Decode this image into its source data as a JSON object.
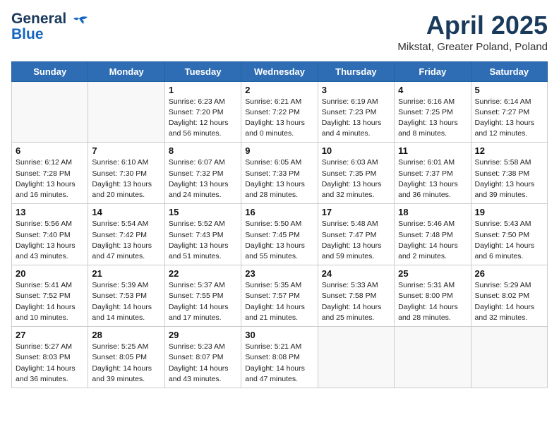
{
  "header": {
    "logo_line1": "General",
    "logo_line2": "Blue",
    "month_year": "April 2025",
    "location": "Mikstat, Greater Poland, Poland"
  },
  "weekdays": [
    "Sunday",
    "Monday",
    "Tuesday",
    "Wednesday",
    "Thursday",
    "Friday",
    "Saturday"
  ],
  "weeks": [
    [
      {
        "day": "",
        "sunrise": "",
        "sunset": "",
        "daylight": ""
      },
      {
        "day": "",
        "sunrise": "",
        "sunset": "",
        "daylight": ""
      },
      {
        "day": "1",
        "sunrise": "Sunrise: 6:23 AM",
        "sunset": "Sunset: 7:20 PM",
        "daylight": "Daylight: 12 hours and 56 minutes."
      },
      {
        "day": "2",
        "sunrise": "Sunrise: 6:21 AM",
        "sunset": "Sunset: 7:22 PM",
        "daylight": "Daylight: 13 hours and 0 minutes."
      },
      {
        "day": "3",
        "sunrise": "Sunrise: 6:19 AM",
        "sunset": "Sunset: 7:23 PM",
        "daylight": "Daylight: 13 hours and 4 minutes."
      },
      {
        "day": "4",
        "sunrise": "Sunrise: 6:16 AM",
        "sunset": "Sunset: 7:25 PM",
        "daylight": "Daylight: 13 hours and 8 minutes."
      },
      {
        "day": "5",
        "sunrise": "Sunrise: 6:14 AM",
        "sunset": "Sunset: 7:27 PM",
        "daylight": "Daylight: 13 hours and 12 minutes."
      }
    ],
    [
      {
        "day": "6",
        "sunrise": "Sunrise: 6:12 AM",
        "sunset": "Sunset: 7:28 PM",
        "daylight": "Daylight: 13 hours and 16 minutes."
      },
      {
        "day": "7",
        "sunrise": "Sunrise: 6:10 AM",
        "sunset": "Sunset: 7:30 PM",
        "daylight": "Daylight: 13 hours and 20 minutes."
      },
      {
        "day": "8",
        "sunrise": "Sunrise: 6:07 AM",
        "sunset": "Sunset: 7:32 PM",
        "daylight": "Daylight: 13 hours and 24 minutes."
      },
      {
        "day": "9",
        "sunrise": "Sunrise: 6:05 AM",
        "sunset": "Sunset: 7:33 PM",
        "daylight": "Daylight: 13 hours and 28 minutes."
      },
      {
        "day": "10",
        "sunrise": "Sunrise: 6:03 AM",
        "sunset": "Sunset: 7:35 PM",
        "daylight": "Daylight: 13 hours and 32 minutes."
      },
      {
        "day": "11",
        "sunrise": "Sunrise: 6:01 AM",
        "sunset": "Sunset: 7:37 PM",
        "daylight": "Daylight: 13 hours and 36 minutes."
      },
      {
        "day": "12",
        "sunrise": "Sunrise: 5:58 AM",
        "sunset": "Sunset: 7:38 PM",
        "daylight": "Daylight: 13 hours and 39 minutes."
      }
    ],
    [
      {
        "day": "13",
        "sunrise": "Sunrise: 5:56 AM",
        "sunset": "Sunset: 7:40 PM",
        "daylight": "Daylight: 13 hours and 43 minutes."
      },
      {
        "day": "14",
        "sunrise": "Sunrise: 5:54 AM",
        "sunset": "Sunset: 7:42 PM",
        "daylight": "Daylight: 13 hours and 47 minutes."
      },
      {
        "day": "15",
        "sunrise": "Sunrise: 5:52 AM",
        "sunset": "Sunset: 7:43 PM",
        "daylight": "Daylight: 13 hours and 51 minutes."
      },
      {
        "day": "16",
        "sunrise": "Sunrise: 5:50 AM",
        "sunset": "Sunset: 7:45 PM",
        "daylight": "Daylight: 13 hours and 55 minutes."
      },
      {
        "day": "17",
        "sunrise": "Sunrise: 5:48 AM",
        "sunset": "Sunset: 7:47 PM",
        "daylight": "Daylight: 13 hours and 59 minutes."
      },
      {
        "day": "18",
        "sunrise": "Sunrise: 5:46 AM",
        "sunset": "Sunset: 7:48 PM",
        "daylight": "Daylight: 14 hours and 2 minutes."
      },
      {
        "day": "19",
        "sunrise": "Sunrise: 5:43 AM",
        "sunset": "Sunset: 7:50 PM",
        "daylight": "Daylight: 14 hours and 6 minutes."
      }
    ],
    [
      {
        "day": "20",
        "sunrise": "Sunrise: 5:41 AM",
        "sunset": "Sunset: 7:52 PM",
        "daylight": "Daylight: 14 hours and 10 minutes."
      },
      {
        "day": "21",
        "sunrise": "Sunrise: 5:39 AM",
        "sunset": "Sunset: 7:53 PM",
        "daylight": "Daylight: 14 hours and 14 minutes."
      },
      {
        "day": "22",
        "sunrise": "Sunrise: 5:37 AM",
        "sunset": "Sunset: 7:55 PM",
        "daylight": "Daylight: 14 hours and 17 minutes."
      },
      {
        "day": "23",
        "sunrise": "Sunrise: 5:35 AM",
        "sunset": "Sunset: 7:57 PM",
        "daylight": "Daylight: 14 hours and 21 minutes."
      },
      {
        "day": "24",
        "sunrise": "Sunrise: 5:33 AM",
        "sunset": "Sunset: 7:58 PM",
        "daylight": "Daylight: 14 hours and 25 minutes."
      },
      {
        "day": "25",
        "sunrise": "Sunrise: 5:31 AM",
        "sunset": "Sunset: 8:00 PM",
        "daylight": "Daylight: 14 hours and 28 minutes."
      },
      {
        "day": "26",
        "sunrise": "Sunrise: 5:29 AM",
        "sunset": "Sunset: 8:02 PM",
        "daylight": "Daylight: 14 hours and 32 minutes."
      }
    ],
    [
      {
        "day": "27",
        "sunrise": "Sunrise: 5:27 AM",
        "sunset": "Sunset: 8:03 PM",
        "daylight": "Daylight: 14 hours and 36 minutes."
      },
      {
        "day": "28",
        "sunrise": "Sunrise: 5:25 AM",
        "sunset": "Sunset: 8:05 PM",
        "daylight": "Daylight: 14 hours and 39 minutes."
      },
      {
        "day": "29",
        "sunrise": "Sunrise: 5:23 AM",
        "sunset": "Sunset: 8:07 PM",
        "daylight": "Daylight: 14 hours and 43 minutes."
      },
      {
        "day": "30",
        "sunrise": "Sunrise: 5:21 AM",
        "sunset": "Sunset: 8:08 PM",
        "daylight": "Daylight: 14 hours and 47 minutes."
      },
      {
        "day": "",
        "sunrise": "",
        "sunset": "",
        "daylight": ""
      },
      {
        "day": "",
        "sunrise": "",
        "sunset": "",
        "daylight": ""
      },
      {
        "day": "",
        "sunrise": "",
        "sunset": "",
        "daylight": ""
      }
    ]
  ]
}
